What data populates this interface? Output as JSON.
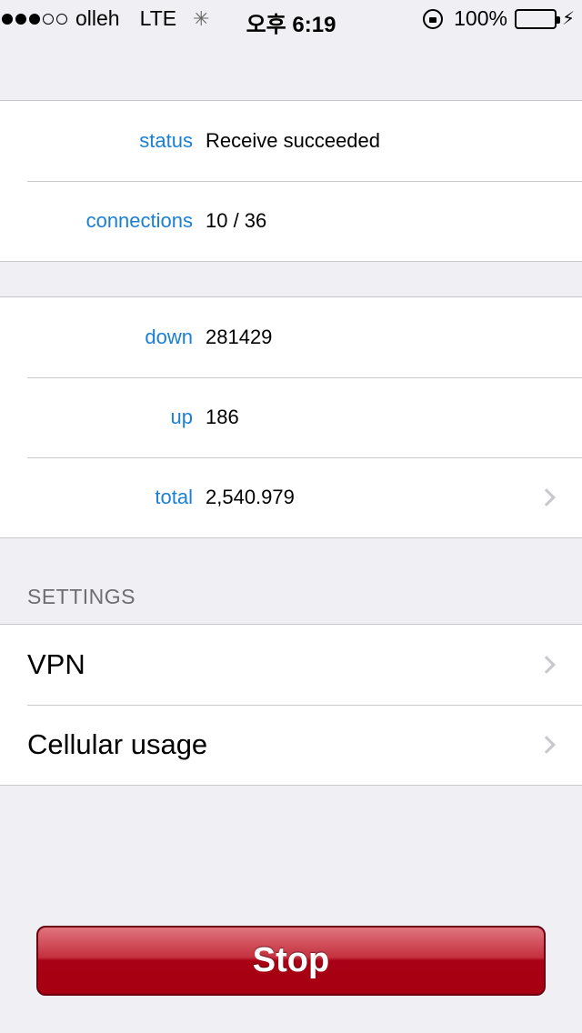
{
  "status_bar": {
    "carrier": "olleh",
    "network": "LTE",
    "time": "오후 6:19",
    "battery_percent": "100%",
    "signal_bars_filled": 3,
    "signal_bars_total": 5
  },
  "stats_group_1": [
    {
      "label": "status",
      "value": "Receive succeeded"
    },
    {
      "label": "connections",
      "value": "10 / 36"
    }
  ],
  "stats_group_2": [
    {
      "label": "down",
      "value": "281429"
    },
    {
      "label": "up",
      "value": "186"
    },
    {
      "label": "total",
      "value": "2,540.979"
    }
  ],
  "settings": {
    "header": "SETTINGS",
    "items": [
      {
        "label": "VPN"
      },
      {
        "label": "Cellular usage"
      }
    ]
  },
  "stop_button": {
    "label": "Stop"
  },
  "colors": {
    "accent": "#1a7fd6",
    "background": "#efeff4",
    "stop_button": "#a60012",
    "battery": "#4cd964"
  }
}
